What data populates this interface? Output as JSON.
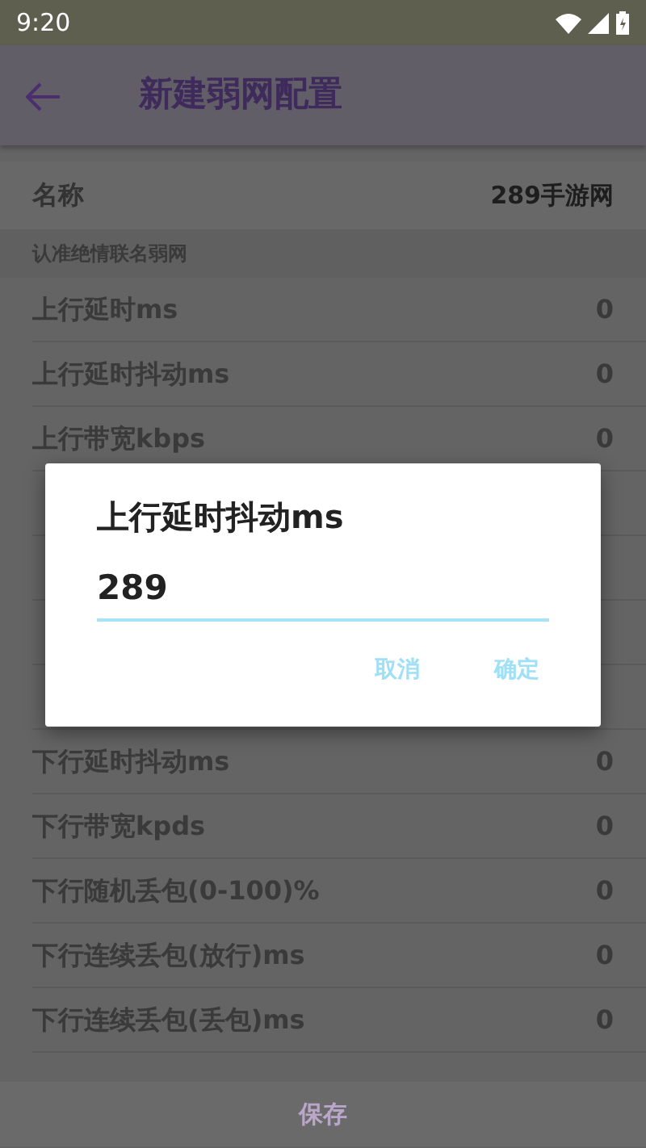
{
  "status_bar": {
    "time": "9:20"
  },
  "app_bar": {
    "title": "新建弱网配置"
  },
  "name_row": {
    "label": "名称",
    "value": "289手游网"
  },
  "section_header": "认准绝情联名弱网",
  "rows": [
    {
      "label": "上行延时ms",
      "value": "0"
    },
    {
      "label": "上行延时抖动ms",
      "value": "0"
    },
    {
      "label": "上行带宽kbps",
      "value": "0"
    },
    {
      "label": "下行延时抖动ms",
      "value": "0"
    },
    {
      "label": "下行带宽kpds",
      "value": "0"
    },
    {
      "label": "下行随机丢包(0-100)%",
      "value": "0"
    },
    {
      "label": "下行连续丢包(放行)ms",
      "value": "0"
    },
    {
      "label": "下行连续丢包(丢包)ms",
      "value": "0"
    }
  ],
  "save_button": "保存",
  "dialog": {
    "title": "上行延时抖动ms",
    "value": "289",
    "buttons": [
      "取消",
      "确定"
    ]
  }
}
